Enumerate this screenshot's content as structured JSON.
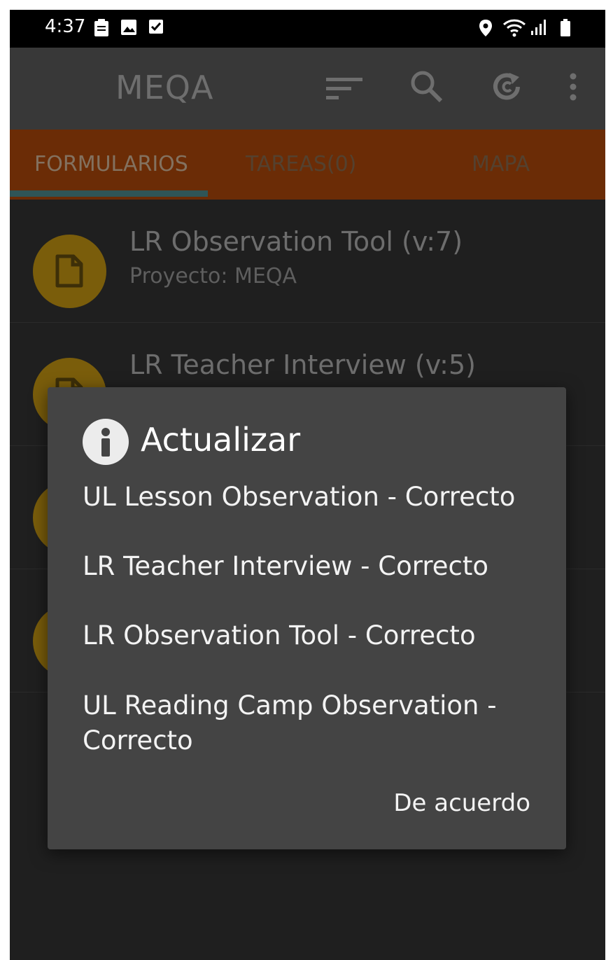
{
  "status_bar": {
    "time": "4:37",
    "icons": [
      "clipboard-icon",
      "image-icon",
      "checkbox-icon",
      "location-icon",
      "wifi-icon",
      "signal-icon",
      "battery-icon"
    ]
  },
  "app_bar": {
    "title": "MEQA",
    "actions": [
      "sort-icon",
      "search-icon",
      "refresh-icon",
      "more-icon"
    ]
  },
  "tabs": [
    {
      "label": "FORMULARIOS",
      "active": true
    },
    {
      "label": "TAREAS(0)",
      "active": false
    },
    {
      "label": "MAPA",
      "active": false
    }
  ],
  "forms": [
    {
      "name": "LR Observation Tool (v:7)",
      "project": "Proyecto: MEQA"
    },
    {
      "name": "LR Teacher Interview (v:5)",
      "project": ""
    }
  ],
  "dialog": {
    "title": "Actualizar",
    "messages": [
      "UL Lesson Observation - Correcto",
      "LR Teacher Interview - Correcto",
      "LR Observation Tool - Correcto",
      "UL Reading Camp Observation - Correcto"
    ],
    "ok_label": "De acuerdo"
  },
  "colors": {
    "tab_bar": "#6b2c06",
    "avatar": "#7a5d0b",
    "dialog_bg": "#444444"
  }
}
